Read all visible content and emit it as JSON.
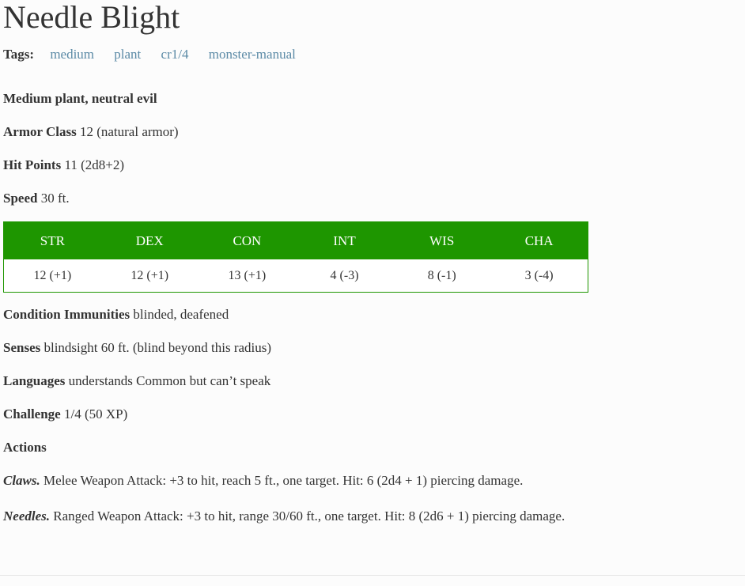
{
  "title": "Needle Blight",
  "tags": {
    "label": "Tags:",
    "items": [
      "medium",
      "plant",
      "cr1/4",
      "monster-manual"
    ]
  },
  "type_line": "Medium plant, neutral evil",
  "armor_class": {
    "label": "Armor Class",
    "value": "12 (natural armor)"
  },
  "hit_points": {
    "label": "Hit Points",
    "value": "11 (2d8+2)"
  },
  "speed": {
    "label": "Speed",
    "value": "30 ft."
  },
  "abilities": {
    "headers": [
      "STR",
      "DEX",
      "CON",
      "INT",
      "WIS",
      "CHA"
    ],
    "values": [
      "12 (+1)",
      "12 (+1)",
      "13 (+1)",
      "4 (-3)",
      "8 (-1)",
      "3 (-4)"
    ]
  },
  "condition_immunities": {
    "label": "Condition Immunities",
    "value": "blinded, deafened"
  },
  "senses": {
    "label": "Senses",
    "value": "blindsight 60 ft. (blind beyond this radius)"
  },
  "languages": {
    "label": "Languages",
    "value": "understands Common but can’t speak"
  },
  "challenge": {
    "label": "Challenge",
    "value": "1/4 (50 XP)"
  },
  "actions_heading": "Actions",
  "actions": [
    {
      "name": "Claws.",
      "text": "Melee Weapon Attack: +3 to hit, reach 5 ft., one target. Hit: 6 (2d4 + 1) piercing damage."
    },
    {
      "name": "Needles.",
      "text": "Ranged Weapon Attack: +3 to hit, range 30/60 ft., one target. Hit: 8 (2d6 + 1) piercing damage."
    }
  ],
  "colors": {
    "accent_green": "#1e9600",
    "tag_link": "#5b8aa6",
    "text": "#333333"
  }
}
